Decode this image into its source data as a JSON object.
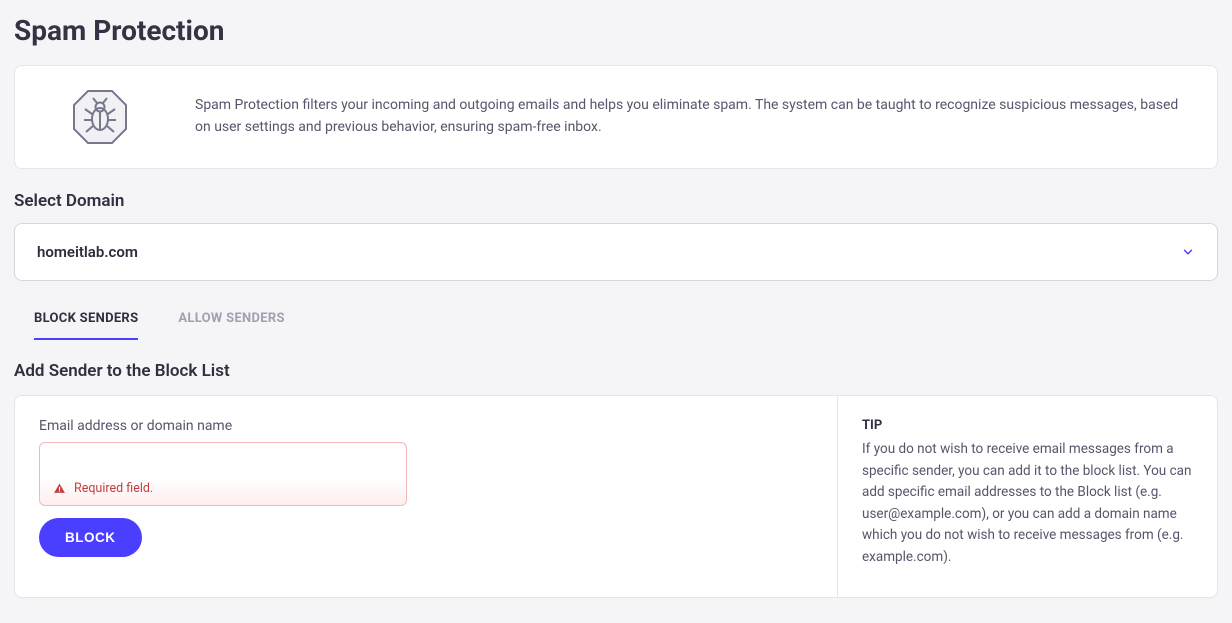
{
  "page": {
    "title": "Spam Protection",
    "intro": "Spam Protection filters your incoming and outgoing emails and helps you eliminate spam. The system can be taught to recognize suspicious messages, based on user settings and previous behavior, ensuring spam-free inbox."
  },
  "domainSelect": {
    "label": "Select Domain",
    "value": "homeitlab.com"
  },
  "tabs": {
    "block": "BLOCK SENDERS",
    "allow": "ALLOW SENDERS",
    "activeIndex": 0
  },
  "blockForm": {
    "heading": "Add Sender to the Block List",
    "fieldLabel": "Email address or domain name",
    "value": "",
    "error": "Required field.",
    "buttonLabel": "BLOCK"
  },
  "tip": {
    "title": "TIP",
    "body": "If you do not wish to receive email messages from a specific sender, you can add it to the block list. You can add specific email addresses to the Block list (e.g. user@example.com), or you can add a domain name which you do not wish to receive messages from (e.g. example.com)."
  },
  "colors": {
    "accent": "#4a3eff",
    "error": "#c44040"
  }
}
